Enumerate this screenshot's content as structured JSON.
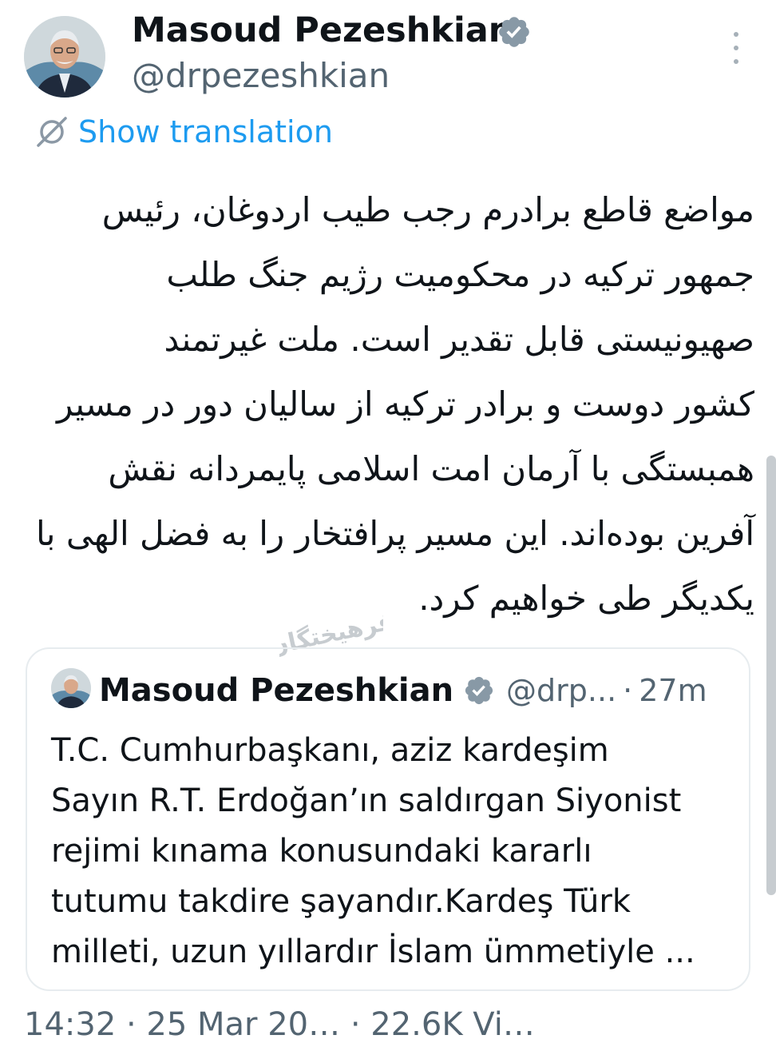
{
  "tweet": {
    "author_name": "Masoud Pezeshkian",
    "author_handle": "@drpezeshkian",
    "show_translation": "Show translation",
    "persian_lines": [
      "مواضع قاطع برادرم رجب طیب اردوغان، رئیس",
      "جمهور ترکیه در محکومیت رژیم جنگ طلب",
      "صهیونیستی قابل تقدیر است. ملت غیرتمند",
      "کشور دوست و برادر ترکیه از سالیان دور در مسیر",
      "همبستگی با آرمان امت اسلامی پایمردانه نقش",
      "آفرین بوده‌اند. این مسیر پرافتخار را به فضل الهی با",
      "یکدیگر طی خواهیم کرد."
    ]
  },
  "watermark_text": "فرهیختگان",
  "quote": {
    "author_name": "Masoud Pezeshkian",
    "author_handle": "@drp...",
    "separator": "·",
    "time": "27m",
    "body_lines": [
      "T.C. Cumhurbaşkanı, aziz kardeşim",
      "Sayın R.T. Erdoğan’ın saldırgan Siyonist",
      "rejimi kınama konusundaki kararlı",
      "tutumu takdire şayandır.Kardeş Türk",
      "milleti, uzun yıllardır İslam ümmetiyle ..."
    ]
  },
  "footer_cutoff": "14:32 · 25 Mar 20… · 22.6K Vi…",
  "colors": {
    "text": "#0f1419",
    "secondary": "#536471",
    "link": "#1d9bf0",
    "border": "#e7ecef",
    "verified_badge": "#8899a6"
  },
  "icons": {
    "verified": "verified-badge-icon",
    "more": "more-vertical-icon",
    "translate": "translate-icon"
  }
}
